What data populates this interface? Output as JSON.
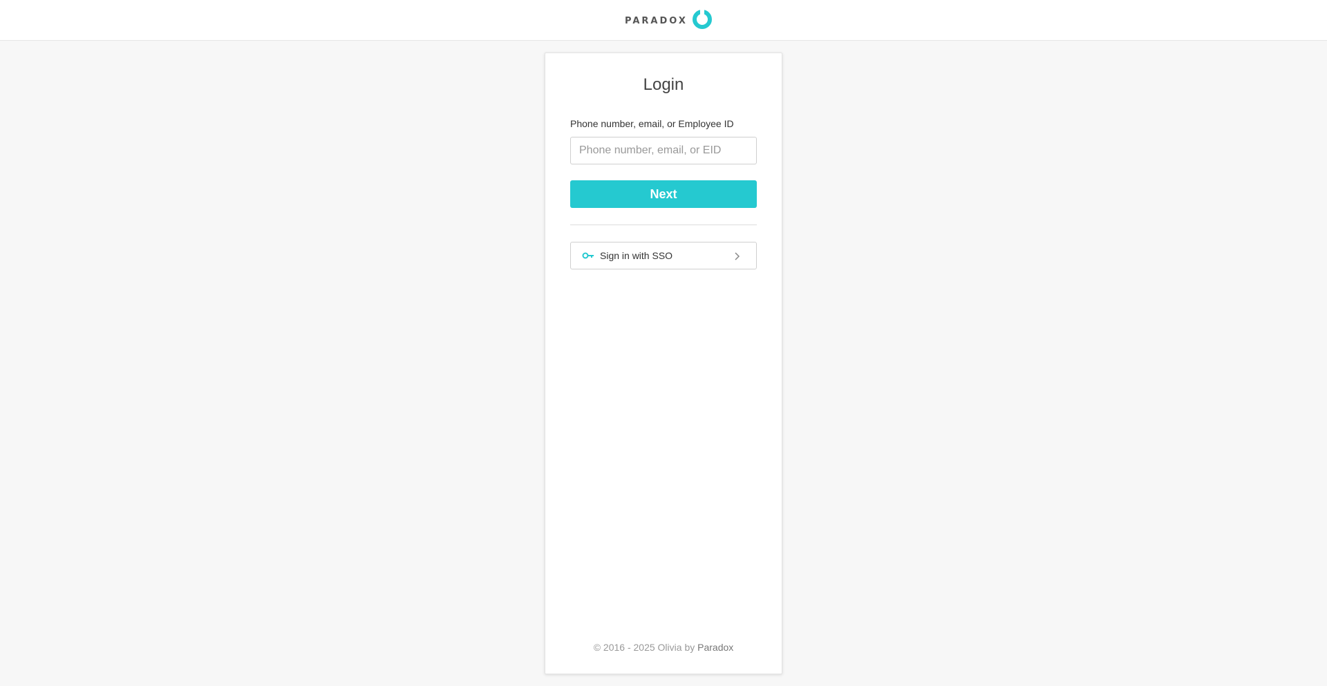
{
  "header": {
    "logo_text": "PARADOX",
    "logo_icon": "paradox-ring-icon",
    "brand_color": "#25c9d0"
  },
  "login": {
    "title": "Login",
    "field_label": "Phone number, email, or Employee ID",
    "input_value": "",
    "input_placeholder": "Phone number, email, or EID",
    "next_label": "Next",
    "sso_label": "Sign in with SSO",
    "sso_icon": "key-icon",
    "chevron_icon": "chevron-right-icon"
  },
  "footer": {
    "copyright": "© 2016 - 2025 Olivia by",
    "brand": "Paradox"
  },
  "colors": {
    "accent": "#25c9d0",
    "background": "#f7f7f7",
    "card": "#ffffff"
  }
}
